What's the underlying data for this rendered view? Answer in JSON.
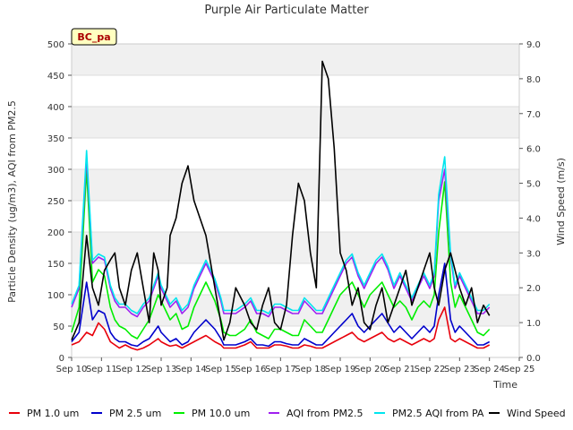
{
  "chart_data": {
    "type": "line",
    "title": "Purple Air Particulate Matter",
    "xlabel": "Time",
    "ylabel": "Particle Density (ug/m3), AQI from PM2.5",
    "y2label": "Wind Speed (m/s)",
    "site_label": "BC_pa",
    "xlim": [
      10,
      25
    ],
    "ylim": [
      0,
      500
    ],
    "y2lim": [
      0,
      9
    ],
    "x_ticks": [
      10,
      11,
      12,
      13,
      14,
      15,
      16,
      17,
      18,
      19,
      20,
      21,
      22,
      23,
      24,
      25
    ],
    "x_tick_labels": [
      "Sep 10",
      "Sep 11",
      "Sep 12",
      "Sep 13",
      "Sep 14",
      "Sep 15",
      "Sep 16",
      "Sep 17",
      "Sep 18",
      "Sep 19",
      "Sep 20",
      "Sep 21",
      "Sep 22",
      "Sep 23",
      "Sep 24",
      "Sep 25"
    ],
    "y_ticks": [
      0,
      50,
      100,
      150,
      200,
      250,
      300,
      350,
      400,
      450,
      500
    ],
    "y2_ticks": [
      "0.0",
      "1.0",
      "2.0",
      "3.0",
      "4.0",
      "5.0",
      "6.0",
      "7.0",
      "8.0",
      "9.0"
    ],
    "grid": "horizontal bands",
    "legend_position": "bottom",
    "x": [
      10.0,
      10.25,
      10.5,
      10.7,
      10.9,
      11.1,
      11.3,
      11.45,
      11.6,
      11.8,
      12.0,
      12.2,
      12.4,
      12.6,
      12.75,
      12.9,
      13.0,
      13.2,
      13.3,
      13.5,
      13.7,
      13.9,
      14.1,
      14.3,
      14.5,
      14.8,
      15.0,
      15.1,
      15.3,
      15.5,
      15.8,
      16.0,
      16.2,
      16.4,
      16.6,
      16.8,
      17.0,
      17.2,
      17.4,
      17.6,
      17.8,
      18.0,
      18.2,
      18.4,
      18.6,
      18.8,
      19.0,
      19.2,
      19.4,
      19.6,
      19.8,
      20.0,
      20.2,
      20.4,
      20.6,
      20.8,
      21.0,
      21.2,
      21.4,
      21.6,
      21.8,
      22.0,
      22.15,
      22.3,
      22.5,
      22.7,
      22.85,
      23.0,
      23.2,
      23.4,
      23.6,
      23.8,
      24.0
    ],
    "series": [
      {
        "name": "PM 1.0 um",
        "color": "#e8000b",
        "values": [
          20,
          25,
          40,
          35,
          55,
          45,
          25,
          20,
          15,
          20,
          15,
          12,
          15,
          20,
          25,
          30,
          25,
          20,
          18,
          20,
          15,
          20,
          25,
          30,
          35,
          25,
          20,
          15,
          15,
          15,
          20,
          25,
          15,
          15,
          15,
          20,
          20,
          18,
          15,
          15,
          20,
          18,
          15,
          15,
          20,
          25,
          30,
          35,
          40,
          30,
          25,
          30,
          35,
          40,
          30,
          25,
          30,
          25,
          20,
          25,
          30,
          25,
          30,
          60,
          80,
          30,
          25,
          30,
          25,
          20,
          15,
          15,
          20
        ]
      },
      {
        "name": "PM 2.5 um",
        "color": "#0000cc",
        "values": [
          25,
          40,
          120,
          60,
          75,
          70,
          40,
          30,
          25,
          25,
          20,
          18,
          25,
          30,
          40,
          50,
          40,
          30,
          25,
          30,
          20,
          25,
          40,
          50,
          60,
          45,
          30,
          20,
          20,
          20,
          25,
          30,
          20,
          20,
          18,
          25,
          25,
          22,
          20,
          20,
          30,
          25,
          20,
          20,
          30,
          40,
          50,
          60,
          70,
          50,
          40,
          50,
          60,
          70,
          55,
          40,
          50,
          40,
          30,
          40,
          50,
          40,
          50,
          100,
          150,
          60,
          40,
          50,
          40,
          30,
          20,
          20,
          25
        ]
      },
      {
        "name": "PM 10.0 um",
        "color": "#00ee00",
        "values": [
          40,
          80,
          300,
          120,
          140,
          130,
          80,
          60,
          50,
          45,
          35,
          30,
          45,
          60,
          80,
          100,
          90,
          70,
          60,
          70,
          45,
          50,
          80,
          100,
          120,
          90,
          60,
          40,
          35,
          35,
          45,
          60,
          40,
          35,
          30,
          45,
          45,
          40,
          35,
          35,
          60,
          50,
          40,
          40,
          60,
          80,
          100,
          110,
          120,
          100,
          80,
          100,
          110,
          120,
          100,
          80,
          90,
          80,
          60,
          80,
          90,
          80,
          100,
          200,
          280,
          120,
          80,
          100,
          80,
          60,
          40,
          35,
          45
        ]
      },
      {
        "name": "AQI from PM2.5",
        "color": "#a020f0",
        "values": [
          80,
          110,
          320,
          150,
          160,
          155,
          110,
          90,
          80,
          80,
          70,
          65,
          80,
          90,
          110,
          130,
          110,
          90,
          80,
          90,
          70,
          80,
          110,
          130,
          150,
          120,
          90,
          70,
          70,
          70,
          80,
          90,
          70,
          70,
          65,
          80,
          80,
          75,
          70,
          70,
          90,
          80,
          70,
          70,
          90,
          110,
          130,
          150,
          160,
          130,
          110,
          130,
          150,
          160,
          140,
          110,
          130,
          110,
          90,
          110,
          130,
          110,
          130,
          250,
          300,
          160,
          110,
          130,
          110,
          90,
          70,
          70,
          80
        ]
      },
      {
        "name": "PM2.5 AQI from PA",
        "color": "#00e5ee",
        "values": [
          85,
          115,
          330,
          155,
          165,
          160,
          115,
          95,
          85,
          85,
          75,
          70,
          85,
          95,
          115,
          135,
          115,
          95,
          85,
          95,
          75,
          85,
          115,
          135,
          155,
          125,
          95,
          75,
          75,
          75,
          85,
          95,
          75,
          75,
          70,
          85,
          85,
          80,
          75,
          75,
          95,
          85,
          75,
          75,
          95,
          115,
          135,
          155,
          165,
          135,
          115,
          135,
          155,
          165,
          145,
          115,
          135,
          115,
          95,
          115,
          135,
          115,
          135,
          260,
          320,
          165,
          115,
          135,
          115,
          95,
          75,
          75,
          85
        ]
      },
      {
        "name": "Wind Speed",
        "color": "#000000",
        "axis": "right",
        "values": [
          0.5,
          1.0,
          3.5,
          2.0,
          1.5,
          2.5,
          2.8,
          3.0,
          2.0,
          1.5,
          2.5,
          3.0,
          2.0,
          1.0,
          3.0,
          2.5,
          1.5,
          2.0,
          3.5,
          4.0,
          5.0,
          5.5,
          4.5,
          4.0,
          3.5,
          2.0,
          1.0,
          0.5,
          1.0,
          2.0,
          1.5,
          1.0,
          0.8,
          1.5,
          2.0,
          1.0,
          0.8,
          1.5,
          3.5,
          5.0,
          4.5,
          3.0,
          2.0,
          8.5,
          8.0,
          6.0,
          3.0,
          2.5,
          1.5,
          2.0,
          1.0,
          0.8,
          1.5,
          2.0,
          1.0,
          1.5,
          2.0,
          2.5,
          1.5,
          2.0,
          2.5,
          3.0,
          2.0,
          1.5,
          2.5,
          3.0,
          2.5,
          2.0,
          1.5,
          2.0,
          1.0,
          1.5,
          1.2
        ]
      }
    ]
  }
}
